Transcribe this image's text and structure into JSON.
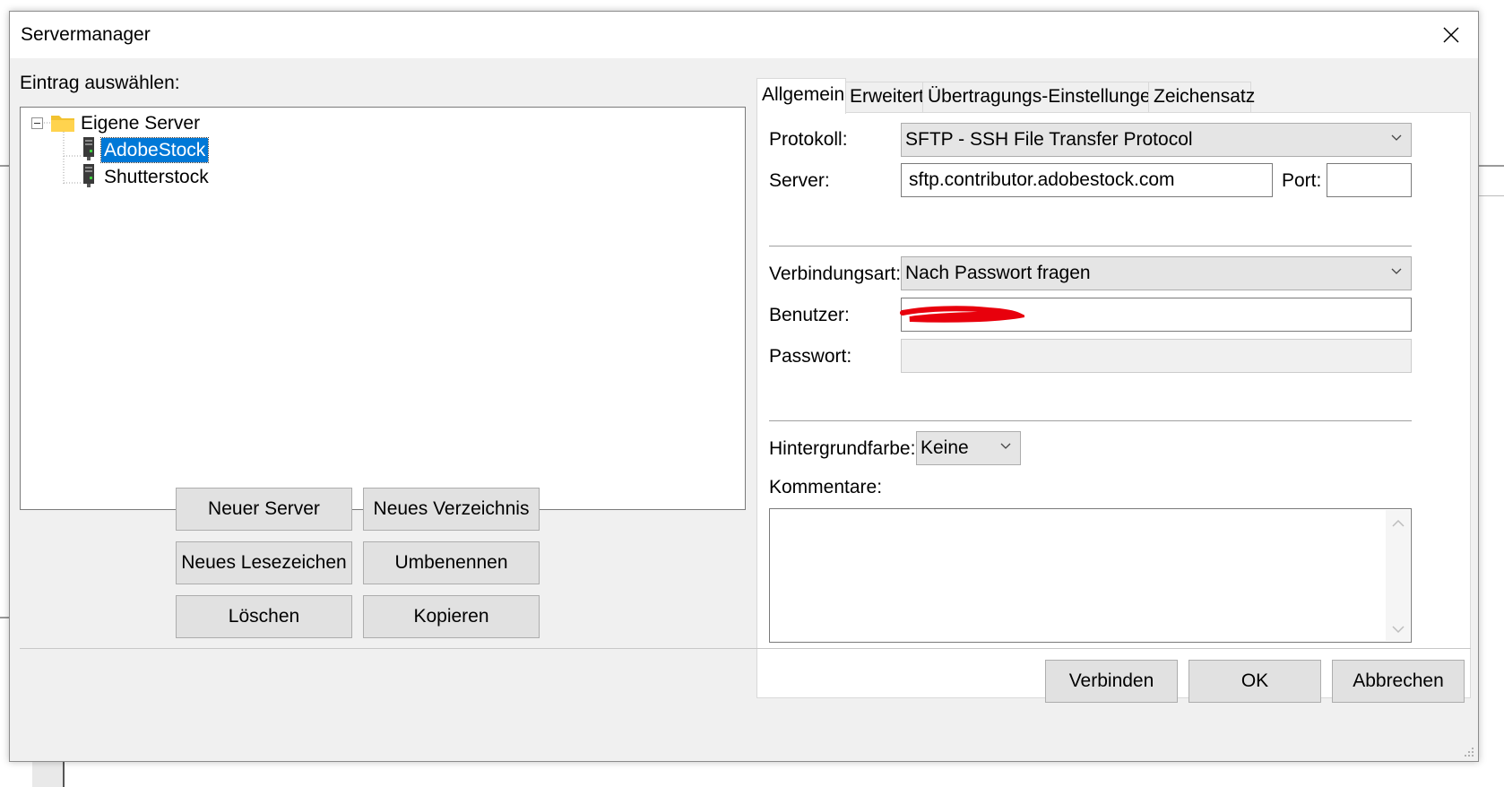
{
  "window": {
    "title": "Servermanager"
  },
  "left": {
    "entry_label": "Eintrag auswählen:",
    "tree": {
      "root": "Eigene Server",
      "children": [
        "AdobeStock",
        "Shutterstock"
      ],
      "selected": "AdobeStock"
    },
    "buttons": {
      "new_server": "Neuer Server",
      "new_folder": "Neues Verzeichnis",
      "new_bookmark": "Neues Lesezeichen",
      "rename": "Umbenennen",
      "delete": "Löschen",
      "copy": "Kopieren"
    }
  },
  "tabs": [
    "Allgemein",
    "Erweitert",
    "Übertragungs-Einstellungen",
    "Zeichensatz"
  ],
  "general": {
    "protocol_label": "Protokoll:",
    "protocol_value": "SFTP - SSH File Transfer Protocol",
    "server_label": "Server:",
    "server_value": "sftp.contributor.adobestock.com",
    "port_label": "Port:",
    "port_value": "",
    "login_type_label": "Verbindungsart:",
    "login_type_value": "Nach Passwort fragen",
    "user_label": "Benutzer:",
    "user_value": "",
    "password_label": "Passwort:",
    "password_value": "",
    "bgcolor_label": "Hintergrundfarbe:",
    "bgcolor_value": "Keine",
    "comments_label": "Kommentare:",
    "comments_value": ""
  },
  "footer": {
    "connect": "Verbinden",
    "ok": "OK",
    "cancel": "Abbrechen"
  },
  "colors": {
    "selection": "#0078d7",
    "redaction": "#e8000c",
    "folder": "#f2c230"
  }
}
